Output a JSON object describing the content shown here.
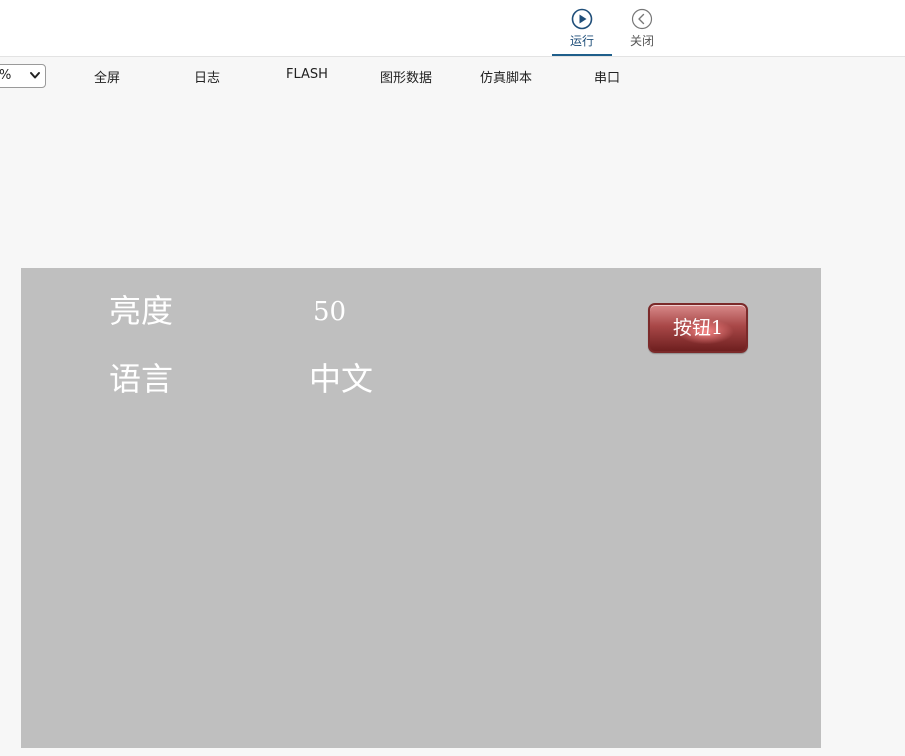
{
  "toolbar": {
    "run_label": "运行",
    "close_label": "关闭"
  },
  "menubar": {
    "zoom_value": "%",
    "items": [
      "全屏",
      "日志",
      "FLASH",
      "图形数据",
      "仿真脚本",
      "串口"
    ]
  },
  "canvas": {
    "brightness_label": "亮度",
    "brightness_value": "50",
    "language_label": "语言",
    "language_value": "中文",
    "button_label": "按钮1"
  },
  "colors": {
    "canvas_bg": "#bfbfbf",
    "accent": "#1f5f8b",
    "button": "#a94848"
  }
}
